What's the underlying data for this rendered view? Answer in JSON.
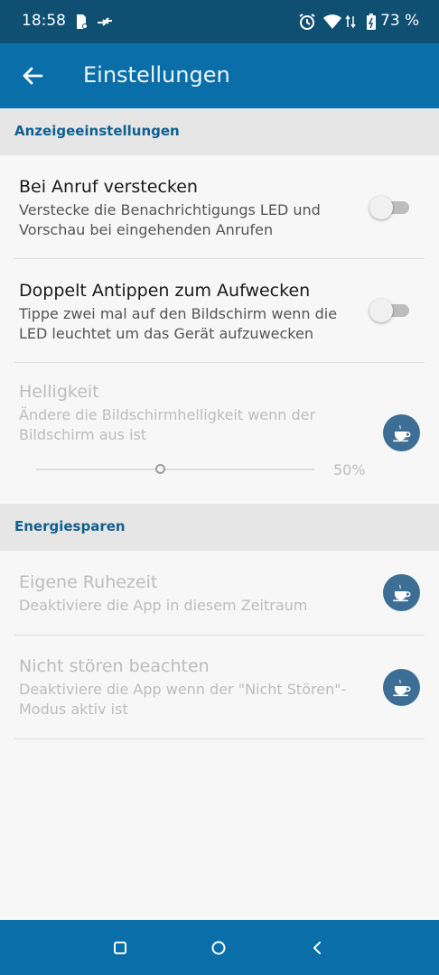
{
  "status_bar": {
    "time": "18:58",
    "battery": "73 %",
    "icons": [
      "notification-icon",
      "data-transfer-icon",
      "alarm-icon",
      "wifi-icon",
      "battery-charging-icon"
    ]
  },
  "app_bar": {
    "title": "Einstellungen",
    "back_icon": "arrow-back-icon"
  },
  "sections": {
    "display": {
      "header": "Anzeigeeinstellungen",
      "hide_on_call": {
        "title": "Bei Anruf verstecken",
        "subtitle": "Verstecke die Benachrichtigungs LED und Vorschau bei eingehenden Anrufen",
        "toggle_on": false
      },
      "double_tap": {
        "title": "Doppelt Antippen zum Aufwecken",
        "subtitle": "Tippe zwei mal auf den Bildschirm wenn die LED leuchtet um das Gerät aufzuwecken",
        "toggle_on": false
      },
      "brightness": {
        "title": "Helligkeit",
        "subtitle": "Ändere die Bildschirmhelligkeit wenn der Bildschirm aus ist",
        "value_label": "50%",
        "value": 0.5,
        "icon": "coffee-cup-icon"
      }
    },
    "energy": {
      "header": "Energiesparen",
      "quiet_time": {
        "title": "Eigene Ruhezeit",
        "subtitle": "Deaktiviere die App in diesem Zeitraum",
        "icon": "coffee-cup-icon"
      },
      "dnd": {
        "title": "Nicht stören beachten",
        "subtitle": "Deaktiviere die App wenn der \"Nicht Stören\"-Modus aktiv ist",
        "icon": "coffee-cup-icon"
      }
    }
  },
  "nav_bar": {
    "buttons": [
      "recents-square-icon",
      "home-circle-icon",
      "back-chevron-icon"
    ]
  },
  "colors": {
    "status_bar": "#0f4f72",
    "app_bar": "#0a6ea8",
    "section_header_text": "#0f5f8f",
    "pro_badge": "#3c6e96"
  }
}
